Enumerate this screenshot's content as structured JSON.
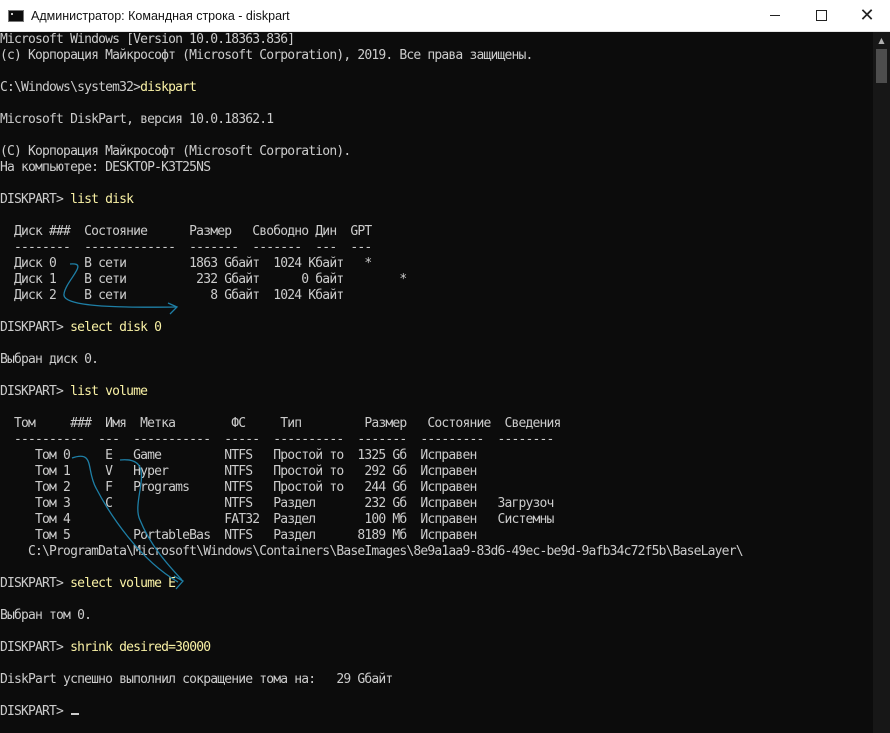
{
  "window": {
    "title": "Администратор: Командная строка - diskpart",
    "icon": "console-icon",
    "controls": {
      "minimize": "minimize-icon",
      "maximize": "maximize-icon",
      "close": "close-icon",
      "close_glyph": "✕"
    }
  },
  "console": {
    "colors": {
      "background": "#0c0c0c",
      "text": "#cccccc",
      "command": "#f9f1a5",
      "annotation": "#1e7fa6"
    },
    "lines": [
      {
        "prompt": "Microsoft Windows [Version 10.0.18363.836]",
        "cmd": ""
      },
      {
        "prompt": "(c) Корпорация Майкрософт (Microsoft Corporation), 2019. Все права защищены.",
        "cmd": ""
      },
      {
        "prompt": "",
        "cmd": ""
      },
      {
        "prompt": "C:\\Windows\\system32>",
        "cmd": "diskpart"
      },
      {
        "prompt": "",
        "cmd": ""
      },
      {
        "prompt": "Microsoft DiskPart, версия 10.0.18362.1",
        "cmd": ""
      },
      {
        "prompt": "",
        "cmd": ""
      },
      {
        "prompt": "(С) Корпорация Майкрософт (Microsoft Corporation).",
        "cmd": ""
      },
      {
        "prompt": "На компьютере: DESKTOP-K3T25NS",
        "cmd": ""
      },
      {
        "prompt": "",
        "cmd": ""
      },
      {
        "prompt": "DISKPART> ",
        "cmd": "list disk"
      },
      {
        "prompt": "",
        "cmd": ""
      },
      {
        "prompt": "  Диск ###  Состояние      Размер   Свободно Дин  GPT",
        "cmd": ""
      },
      {
        "prompt": "  --------  -------------  -------  -------  ---  ---",
        "cmd": ""
      },
      {
        "prompt": "  Диск 0    В сети         1863 Gбайт  1024 Kбайт   *",
        "cmd": ""
      },
      {
        "prompt": "  Диск 1    В сети          232 Gбайт      0 байт        *",
        "cmd": ""
      },
      {
        "prompt": "  Диск 2    В сети            8 Gбайт  1024 Kбайт",
        "cmd": ""
      },
      {
        "prompt": "",
        "cmd": ""
      },
      {
        "prompt": "DISKPART> ",
        "cmd": "select disk 0"
      },
      {
        "prompt": "",
        "cmd": ""
      },
      {
        "prompt": "Выбран диск 0.",
        "cmd": ""
      },
      {
        "prompt": "",
        "cmd": ""
      },
      {
        "prompt": "DISKPART> ",
        "cmd": "list volume"
      },
      {
        "prompt": "",
        "cmd": ""
      },
      {
        "prompt": "  Том     ###  Имя  Метка        ФС     Тип         Размер   Состояние  Сведения",
        "cmd": ""
      },
      {
        "prompt": "  ----------  ---  -----------  -----  ----------  -------  ---------  --------",
        "cmd": ""
      },
      {
        "prompt": "     Том 0     E   Game         NTFS   Простой то  1325 Gб  Исправен",
        "cmd": ""
      },
      {
        "prompt": "     Том 1     V   Hyper        NTFS   Простой то   292 Gб  Исправен",
        "cmd": ""
      },
      {
        "prompt": "     Том 2     F   Programs     NTFS   Простой то   244 Gб  Исправен",
        "cmd": ""
      },
      {
        "prompt": "     Том 3     C                NTFS   Раздел       232 Gб  Исправен   Загрузоч",
        "cmd": ""
      },
      {
        "prompt": "     Том 4                      FAT32  Раздел       100 Мб  Исправен   Системны",
        "cmd": ""
      },
      {
        "prompt": "     Том 5         PortableBas  NTFS   Раздел      8189 Мб  Исправен",
        "cmd": ""
      },
      {
        "prompt": "    C:\\ProgramData\\Microsoft\\Windows\\Containers\\BaseImages\\8e9a1aa9-83d6-49ec-be9d-9afb34c72f5b\\BaseLayer\\",
        "cmd": ""
      },
      {
        "prompt": "",
        "cmd": ""
      },
      {
        "prompt": "DISKPART> ",
        "cmd": "select volume E"
      },
      {
        "prompt": "",
        "cmd": ""
      },
      {
        "prompt": "Выбран том 0.",
        "cmd": ""
      },
      {
        "prompt": "",
        "cmd": ""
      },
      {
        "prompt": "DISKPART> ",
        "cmd": "shrink desired=30000"
      },
      {
        "prompt": "",
        "cmd": ""
      },
      {
        "prompt": "DiskPart успешно выполнил сокращение тома на:   29 Gбайт",
        "cmd": ""
      },
      {
        "prompt": "",
        "cmd": ""
      },
      {
        "prompt": "DISKPART> ",
        "cmd": ""
      }
    ]
  },
  "scrollbar": {
    "up_arrow": "▲"
  }
}
